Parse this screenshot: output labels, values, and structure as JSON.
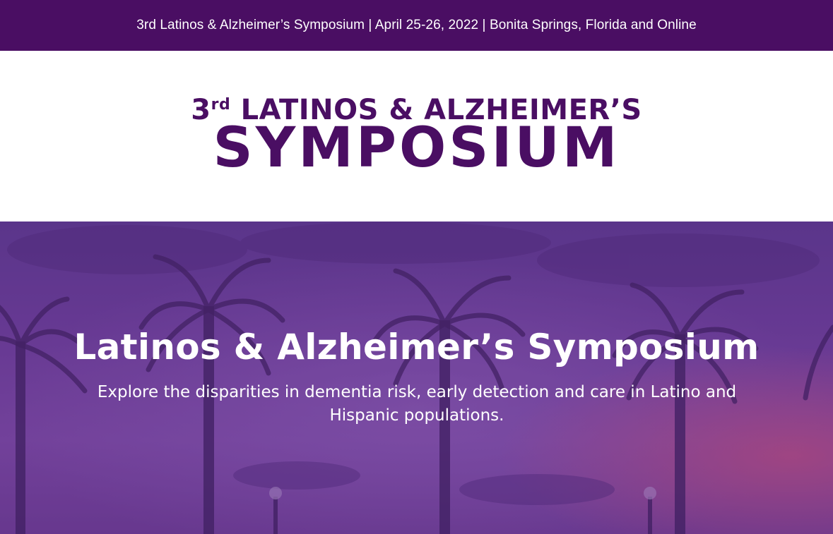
{
  "banner": {
    "text": "3rd Latinos & Alzheimer’s Symposium | April 25-26, 2022 | Bonita Springs, Florida and Online"
  },
  "logo": {
    "ordinal_number": "3",
    "ordinal_suffix": "rd",
    "line1_rest": " LATINOS & ALZHEIMER’S",
    "line2": "SYMPOSIUM"
  },
  "hero": {
    "title": "Latinos & Alzheimer’s Symposium",
    "subtitle": "Explore the disparities in dementia risk, early detection and care in Latino and Hispanic populations."
  },
  "colors": {
    "brand_purple": "#4a0e63",
    "hero_purple": "#6a3f95",
    "text_white": "#ffffff"
  }
}
